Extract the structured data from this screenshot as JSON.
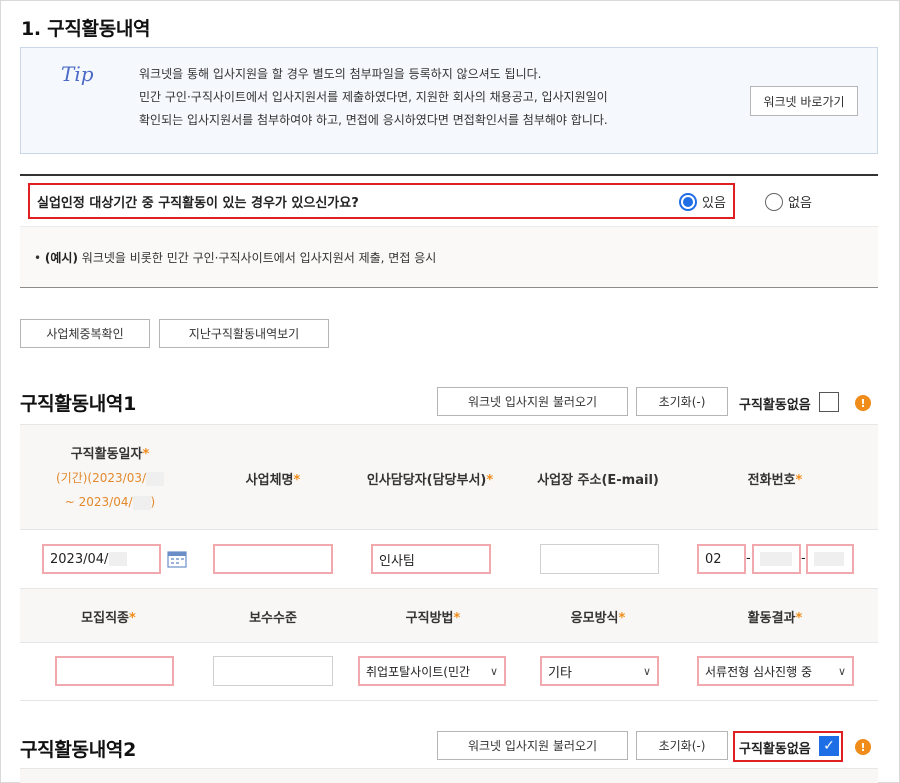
{
  "section": {
    "title": "1. 구직활동내역"
  },
  "tip": {
    "logo": "Tip",
    "lines": [
      "워크넷을 통해 입사지원을 할 경우 별도의 첨부파일을 등록하지 않으셔도 됩니다.",
      "민간 구인·구직사이트에서 입사지원서를 제출하였다면, 지원한 회사의 채용공고, 입사지원일이",
      "확인되는 입사지원서를 첨부하여야 하고, 면접에 응시하였다면 면접확인서를 첨부해야 합니다."
    ],
    "worknet_button": "워크넷 바로가기"
  },
  "question": {
    "text": "실업인정 대상기간 중 구직활동이 있는 경우가 있으신가요?",
    "yes": "있음",
    "no": "없음",
    "selected": "yes"
  },
  "example": {
    "prefix": "(예시)",
    "text": " 워크넷을 비롯한 민간 구인·구직사이트에서 입사지원서 제출, 면접 응시"
  },
  "buttons": {
    "duplicate_check": "사업체중복확인",
    "past_history": "지난구직활동내역보기"
  },
  "activity1": {
    "title": "구직활동내역1",
    "load_button": "워크넷 입사지원 불러오기",
    "reset_button": "초기화(-)",
    "none_label": "구직활동없음",
    "none_checked": false,
    "headers1": {
      "date": "구직활동일자",
      "period_line1": "(기간)(2023/03/",
      "period_line2": "~ 2023/04/",
      "period_close": ")",
      "company": "사업체명",
      "manager": "인사담당자(담당부서)",
      "email": "사업장 주소(E-mail)",
      "phone": "전화번호"
    },
    "values1": {
      "date": "2023/04/",
      "company": "",
      "manager": "인사팀",
      "email": "",
      "phone_area": "02",
      "phone_sep": "-"
    },
    "headers2": {
      "job": "모집직종",
      "salary": "보수수준",
      "method": "구직방법",
      "apply": "응모방식",
      "result": "활동결과"
    },
    "values2": {
      "job": "",
      "salary": "",
      "method": "취업포탈사이트(민간",
      "apply": "기타",
      "result": "서류전형 심사진행 중"
    },
    "required_mark": "*"
  },
  "activity2": {
    "title": "구직활동내역2",
    "load_button": "워크넷 입사지원 불러오기",
    "reset_button": "초기화(-)",
    "none_label": "구직활동없음",
    "none_checked": true
  },
  "colors": {
    "accent": "#1e6ee6",
    "required": "#f08c1a",
    "highlight": "#e02020",
    "required_border": "#f2a9ad"
  }
}
